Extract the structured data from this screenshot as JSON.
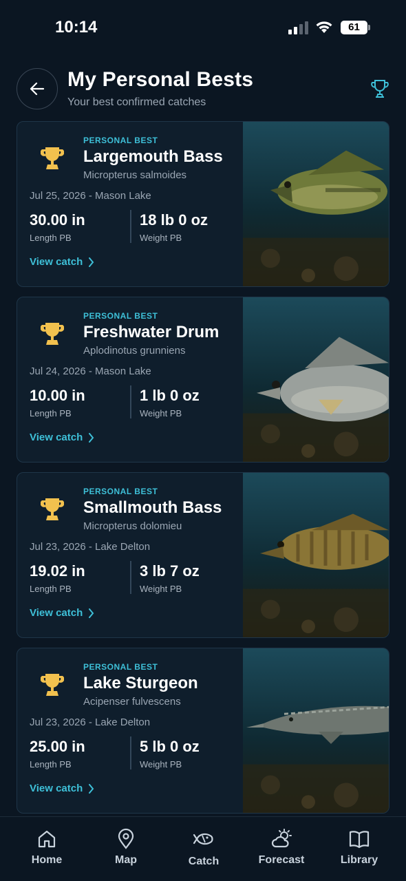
{
  "status_bar": {
    "time": "10:14",
    "battery": "61"
  },
  "header": {
    "title": "My Personal Bests",
    "subtitle": "Your best confirmed catches"
  },
  "colors": {
    "accent": "#3ec0d8",
    "trophy": "#f2c14e",
    "background": "#0b1622",
    "card": "#0f1e2c"
  },
  "cards": [
    {
      "badge": "PERSONAL BEST",
      "name": "Largemouth Bass",
      "scientific": "Micropterus salmoides",
      "meta": "Jul 25, 2026 - Mason Lake",
      "length_value": "30.00 in",
      "length_label": "Length PB",
      "weight_value": "18 lb 0 oz",
      "weight_label": "Weight PB",
      "link": "View catch",
      "photo": "largemouth-bass-photo"
    },
    {
      "badge": "PERSONAL BEST",
      "name": "Freshwater Drum",
      "scientific": "Aplodinotus grunniens",
      "meta": "Jul 24, 2026 - Mason Lake",
      "length_value": "10.00 in",
      "length_label": "Length PB",
      "weight_value": "1 lb 0 oz",
      "weight_label": "Weight PB",
      "link": "View catch",
      "photo": "freshwater-drum-photo"
    },
    {
      "badge": "PERSONAL BEST",
      "name": "Smallmouth Bass",
      "scientific": "Micropterus dolomieu",
      "meta": "Jul 23, 2026 - Lake Delton",
      "length_value": "19.02 in",
      "length_label": "Length PB",
      "weight_value": "3 lb 7 oz",
      "weight_label": "Weight PB",
      "link": "View catch",
      "photo": "smallmouth-bass-photo"
    },
    {
      "badge": "PERSONAL BEST",
      "name": "Lake Sturgeon",
      "scientific": "Acipenser fulvescens",
      "meta": "Jul 23, 2026 - Lake Delton",
      "length_value": "25.00 in",
      "length_label": "Length PB",
      "weight_value": "5 lb 0 oz",
      "weight_label": "Weight PB",
      "link": "View catch",
      "photo": "lake-sturgeon-photo"
    }
  ],
  "nav": [
    {
      "label": "Home",
      "icon": "home-icon"
    },
    {
      "label": "Map",
      "icon": "map-pin-icon"
    },
    {
      "label": "Catch",
      "icon": "fish-icon"
    },
    {
      "label": "Forecast",
      "icon": "weather-icon"
    },
    {
      "label": "Library",
      "icon": "book-icon"
    }
  ]
}
